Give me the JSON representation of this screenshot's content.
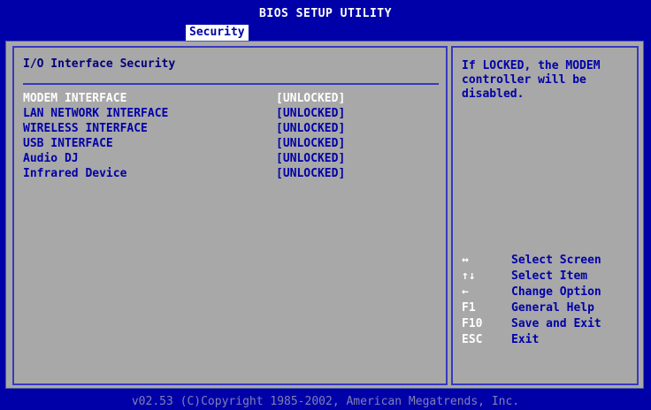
{
  "header": {
    "title": "BIOS SETUP UTILITY",
    "active_tab": "Security"
  },
  "main": {
    "section_title": "I/O Interface Security",
    "items": [
      {
        "label": "MODEM INTERFACE",
        "value": "[UNLOCKED]",
        "selected": true
      },
      {
        "label": "LAN NETWORK INTERFACE",
        "value": "[UNLOCKED]",
        "selected": false
      },
      {
        "label": "WIRELESS INTERFACE",
        "value": "[UNLOCKED]",
        "selected": false
      },
      {
        "label": "USB INTERFACE",
        "value": "[UNLOCKED]",
        "selected": false
      },
      {
        "label": "Audio DJ",
        "value": "[UNLOCKED]",
        "selected": false
      },
      {
        "label": "Infrared Device",
        "value": "[UNLOCKED]",
        "selected": false
      }
    ]
  },
  "help": {
    "text": "If LOCKED, the MODEM\ncontroller will be\ndisabled.",
    "keys": [
      {
        "key": "↔",
        "desc": "Select Screen"
      },
      {
        "key": "↑↓",
        "desc": "Select Item"
      },
      {
        "key": "←",
        "desc": "Change Option"
      },
      {
        "key": "F1",
        "desc": "General Help"
      },
      {
        "key": "F10",
        "desc": "Save and Exit"
      },
      {
        "key": "ESC",
        "desc": "Exit"
      }
    ]
  },
  "footer": {
    "text": "v02.53 (C)Copyright 1985-2002, American Megatrends, Inc."
  },
  "colors": {
    "background": "#0000a8",
    "panel": "#a8a8a8",
    "highlight": "#ffffff"
  }
}
